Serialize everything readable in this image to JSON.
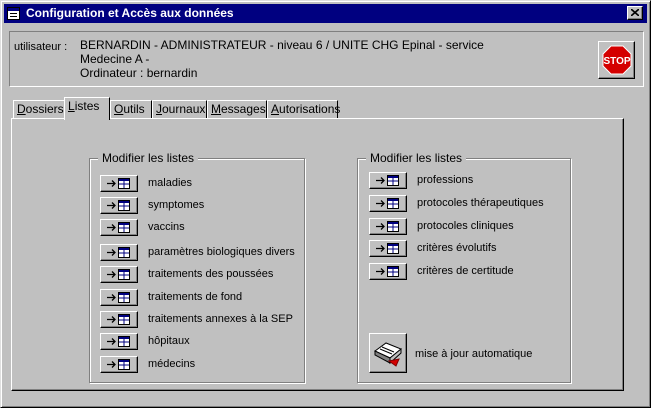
{
  "window": {
    "title": "Configuration et Accès aux données",
    "colors": {
      "titlebar": "#000080",
      "face": "#c0c0c0",
      "stop": "#d40000"
    }
  },
  "user": {
    "label": "utilisateur :",
    "line1": "BERNARDIN - ADMINISTRATEUR - niveau 6 / UNITE CHG Epinal - service Medecine A -",
    "line2": "Ordinateur : bernardin"
  },
  "stop_button": {
    "text": "STOP",
    "icon": "stop-sign-icon"
  },
  "tabs": [
    {
      "pre": "",
      "u": "D",
      "post": "ossiers"
    },
    {
      "pre": "",
      "u": "L",
      "post": "istes"
    },
    {
      "pre": "",
      "u": "O",
      "post": "utils"
    },
    {
      "pre": "",
      "u": "J",
      "post": "ournaux"
    },
    {
      "pre": "",
      "u": "M",
      "post": "essages"
    },
    {
      "pre": "",
      "u": "A",
      "post": "utorisations"
    }
  ],
  "left_group": {
    "title": "Modifier les listes",
    "items": [
      "maladies",
      "symptomes",
      "vaccins",
      "paramètres biologiques divers",
      "traitements des poussées",
      "traitements de fond",
      "traitements annexes à la SEP",
      "hôpitaux",
      "médecins"
    ]
  },
  "right_group": {
    "title": "Modifier les listes",
    "items": [
      "professions",
      "protocoles thérapeutiques",
      "protocoles cliniques",
      "critères évolutifs",
      "critères de certitude"
    ],
    "auto_update": "mise à jour automatique"
  }
}
